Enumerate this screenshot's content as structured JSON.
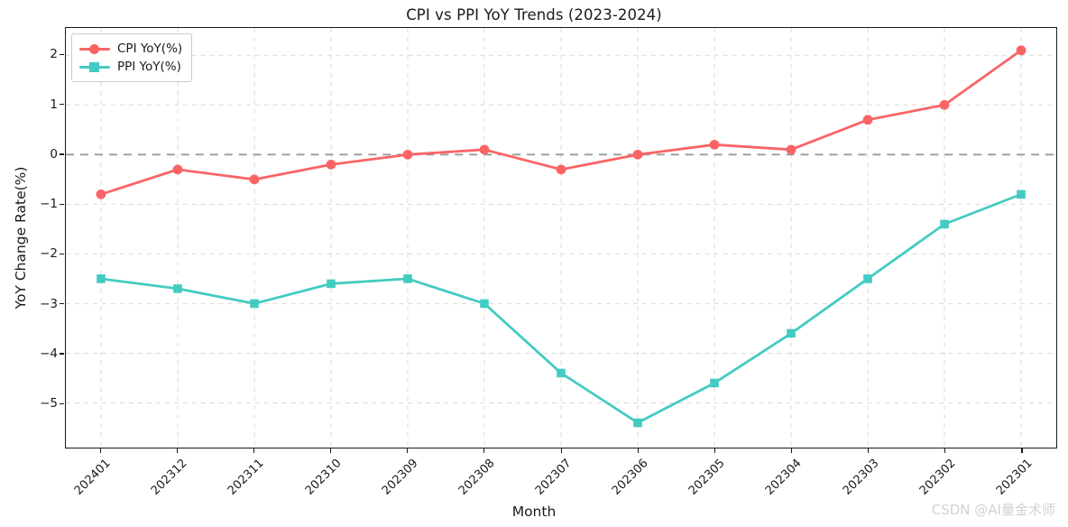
{
  "chart_data": {
    "type": "line",
    "title": "CPI vs PPI YoY Trends (2023-2024)",
    "xlabel": "Month",
    "ylabel": "YoY Change Rate(%)",
    "categories": [
      "202401",
      "202312",
      "202311",
      "202310",
      "202309",
      "202308",
      "202307",
      "202306",
      "202305",
      "202304",
      "202303",
      "202302",
      "202301"
    ],
    "series": [
      {
        "name": "CPI YoY(%)",
        "color": "#fa6465",
        "marker": "circle",
        "values": [
          -0.8,
          -0.3,
          -0.5,
          -0.2,
          0.0,
          0.1,
          -0.3,
          0.0,
          0.2,
          0.1,
          0.7,
          1.0,
          2.1
        ]
      },
      {
        "name": "PPI YoY(%)",
        "color": "#43cbc2",
        "marker": "square",
        "values": [
          -2.5,
          -2.7,
          -3.0,
          -2.6,
          -2.5,
          -3.0,
          -4.4,
          -5.4,
          -4.6,
          -3.6,
          -2.5,
          -1.4,
          -0.8
        ]
      }
    ],
    "yticks": [
      2,
      1,
      0,
      -1,
      -2,
      -3,
      -4,
      -5
    ],
    "ytick_labels": [
      "2",
      "1",
      "0",
      "−1",
      "−2",
      "−3",
      "−4",
      "−5"
    ],
    "ylim": [
      -5.9,
      2.55
    ],
    "grid": true,
    "grid_color": "#d9d9d9",
    "zero_line": {
      "value": 0,
      "color": "#9a9a9a",
      "style": "dashed"
    },
    "legend_position": "upper left",
    "background": "#ffffff",
    "axis_color": "#1a1a1a"
  },
  "watermark": {
    "text": "CSDN @AI量金术师"
  }
}
